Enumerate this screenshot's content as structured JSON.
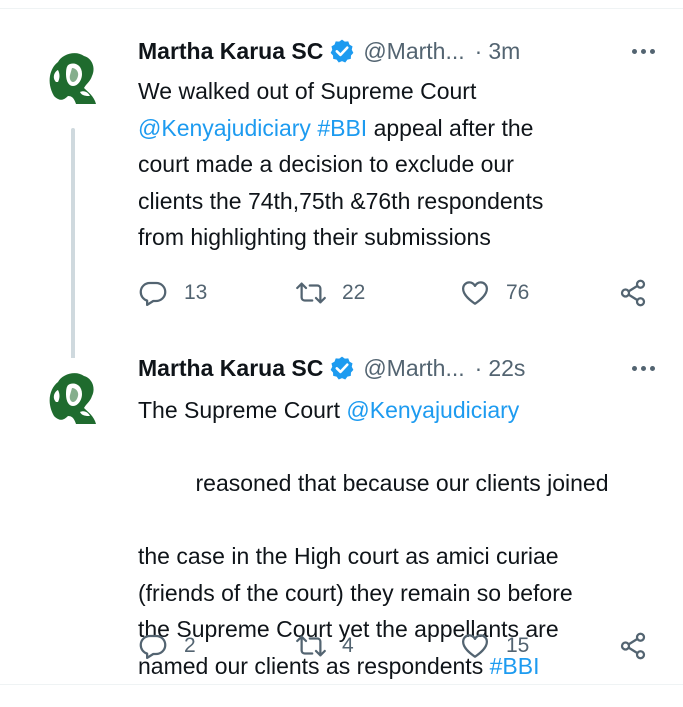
{
  "tweets": [
    {
      "author_name": "Martha Karua SC",
      "handle": "@Marth...",
      "separator": "·",
      "time": "3m",
      "body": [
        [
          {
            "text": "We walked out of Supreme Court",
            "link": false
          }
        ],
        [
          {
            "text": "@Kenyajudiciary",
            "link": true
          },
          {
            "text": " ",
            "link": false
          },
          {
            "text": "#BBI",
            "link": true
          },
          {
            "text": " appeal after the",
            "link": false
          }
        ],
        [
          {
            "text": "court made a decision to exclude our",
            "link": false
          }
        ],
        [
          {
            "text": "clients the 74th,75th &76th respondents",
            "link": false
          }
        ],
        [
          {
            "text": "from highlighting their submissions",
            "link": false
          }
        ]
      ],
      "replies": "13",
      "retweets": "22",
      "likes": "76"
    },
    {
      "author_name": "Martha Karua SC",
      "handle": "@Marth...",
      "separator": "·",
      "time": "22s",
      "body": [
        [
          {
            "text": "The Supreme Court ",
            "link": false
          },
          {
            "text": "@Kenyajudiciary",
            "link": true
          }
        ],
        [
          {
            "text": " reasoned that because our clients joined",
            "link": false
          }
        ],
        [
          {
            "text": "the case in the High court as amici curiae",
            "link": false
          }
        ],
        [
          {
            "text": "(friends of the court) they remain so before",
            "link": false
          }
        ],
        [
          {
            "text": "the Supreme Court yet the appellants are",
            "link": false
          }
        ],
        [
          {
            "text": "named our clients as respondents ",
            "link": false
          },
          {
            "text": "#BBI",
            "link": true
          }
        ]
      ],
      "replies": "2",
      "retweets": "4",
      "likes": "15"
    }
  ],
  "icons": {
    "verified": "verified-badge-icon",
    "more": "more-options-icon",
    "reply": "reply-icon",
    "retweet": "retweet-icon",
    "like": "like-heart-icon",
    "share": "share-icon"
  },
  "colors": {
    "link": "#1d9bf0",
    "secondary_text": "#536471",
    "avatar_green": "#1f6b2e",
    "verified_blue": "#1d9bf0"
  }
}
